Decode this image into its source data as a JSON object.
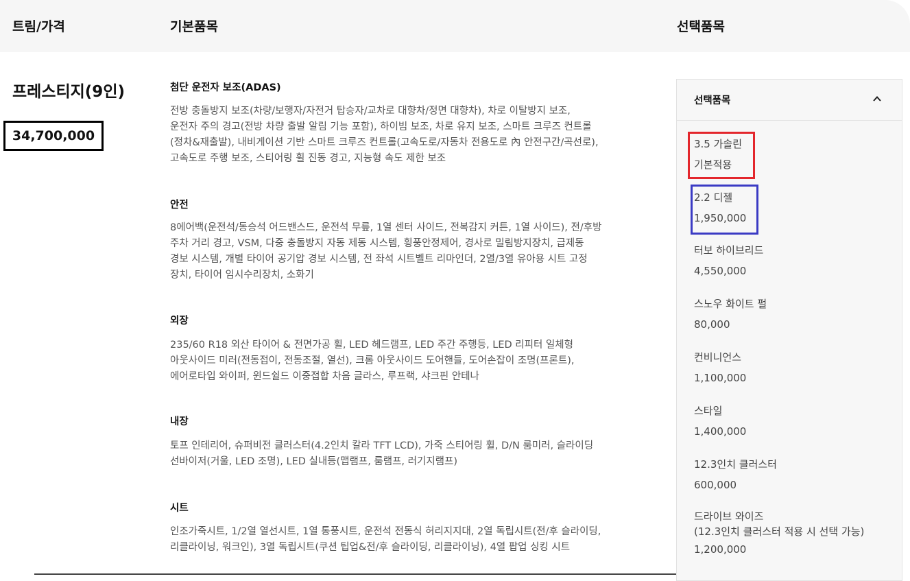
{
  "header": {
    "trim_price": "트림/가격",
    "basic_items": "기본품목",
    "selected_items": "선택품목"
  },
  "trim": {
    "name": "프레스티지(9인)",
    "price": "34,700,000"
  },
  "basic_sections": [
    {
      "title": "첨단 운전자 보조(ADAS)",
      "lines": [
        "전방 충돌방지 보조(차량/보행자/자전거 탑승자/교차로 대향차/정면 대향차), 차로 이탈방지 보조,",
        "운전자 주의 경고(전방 차량 출발 알림 기능 포함), 하이빔 보조, 차로 유지 보조, 스마트 크루즈 컨트롤",
        "(정차&재출발), 내비게이션 기반 스마트 크루즈 컨트롤(고속도로/자동차 전용도로 內 안전구간/곡선로),",
        "고속도로 주행 보조, 스티어링 휠 진동 경고, 지능형 속도 제한 보조"
      ]
    },
    {
      "title": "안전",
      "lines": [
        "8에어백(운전석/동승석 어드밴스드, 운전석 무릎, 1열 센터 사이드, 전복감지 커튼, 1열 사이드), 전/후방",
        "주차 거리 경고, VSM, 다중 충돌방지 자동 제동 시스템, 횡풍안정제어, 경사로 밀림방지장치, 급제동",
        "경보 시스템, 개별 타이어 공기압 경보 시스템, 전 좌석 시트벨트 리마인더, 2열/3열 유아용 시트 고정",
        "장치, 타이어 임시수리장치, 소화기"
      ]
    },
    {
      "title": "외장",
      "lines": [
        "235/60 R18 외산 타이어 & 전면가공 휠, LED 헤드램프, LED 주간 주행등, LED 리피터 일체형",
        "아웃사이드 미러(전동접이, 전동조절, 열선), 크롬 아웃사이드 도어핸들, 도어손잡이 조명(프론트),",
        "에어로타입 와이퍼, 윈드쉴드 이중접합 차음 글라스, 루프랙, 샤크핀 안테나"
      ]
    },
    {
      "title": "내장",
      "lines": [
        "토프 인테리어, 슈퍼비전 클러스터(4.2인치 칼라 TFT LCD), 가죽 스티어링 휠, D/N 룸미러, 슬라이딩",
        "선바이저(거울, LED 조명), LED 실내등(맵램프, 룸램프, 러기지램프)"
      ]
    },
    {
      "title": "시트",
      "lines": [
        "인조가죽시트, 1/2열 열선시트, 1열 통풍시트, 운전석 전동식 허리지지대, 2열 독립시트(전/후 슬라이딩,",
        "리클라이닝, 워크인), 3열 독립시트(쿠션 팁업&전/후 슬라이딩, 리클라이닝), 4열 팝업 싱킹 시트"
      ]
    }
  ],
  "options_panel": {
    "title": "선택품목",
    "toggle_icon": "chevron-up-icon",
    "items": [
      {
        "name": "3.5 가솔린",
        "price": "기본적용"
      },
      {
        "name": "2.2 디젤",
        "price": "1,950,000"
      },
      {
        "name": "터보 하이브리드",
        "price": "4,550,000"
      },
      {
        "name": "스노우 화이트 펄",
        "price": "80,000"
      },
      {
        "name": "컨비니언스",
        "price": "1,100,000"
      },
      {
        "name": "스타일",
        "price": "1,400,000"
      },
      {
        "name": "12.3인치 클러스터",
        "price": "600,000"
      },
      {
        "name": "드라이브 와이즈",
        "sub": "(12.3인치 클러스터 적용 시 선택 가능)",
        "price": "1,200,000"
      }
    ]
  },
  "annotation_colors": {
    "red_box": "#e3262c",
    "blue_box": "#3b3bc4",
    "black_box": "#000000"
  }
}
